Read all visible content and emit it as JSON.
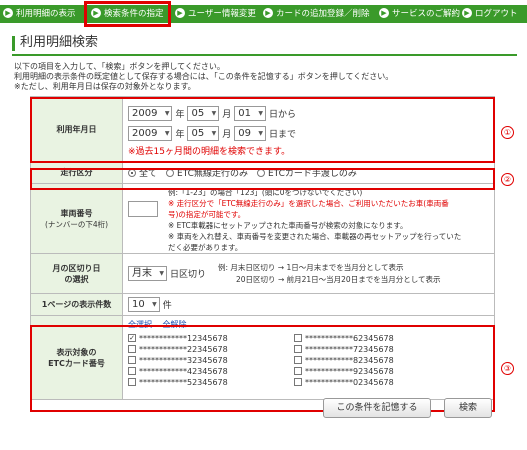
{
  "nav": {
    "items": [
      "利用明細の表示",
      "検索条件の指定",
      "ユーザー情報変更",
      "カードの追加登録／削除",
      "サービスのご解約",
      "ログアウト"
    ]
  },
  "page": {
    "title": "利用明細検索",
    "intro": [
      "以下の項目を入力して、「検索」ボタンを押してください。",
      "利用明細の表示条件の既定値として保存する場合には、「この条件を記憶する」ボタンを押してください。",
      "※ただし、利用年月日は保存の対象外となります。"
    ]
  },
  "date": {
    "label": "利用年月日",
    "from": {
      "year": "2009",
      "month": "05",
      "day": "01",
      "suffix": "日から"
    },
    "to": {
      "year": "2009",
      "month": "05",
      "day": "09",
      "suffix": "日まで"
    },
    "year_unit": "年",
    "month_unit": "月",
    "warning": "※過去15ヶ月間の明細を検索できます。"
  },
  "route": {
    "label": "走行区分",
    "options": [
      "全て",
      "ETC無線走行のみ",
      "ETCカード手渡しのみ"
    ],
    "selected": 0
  },
  "vehicle": {
    "label": "車両番号",
    "sub": "(ナンバーの下4桁)",
    "example": "例:「1-23」の場合「123」(頭に0をつけないでください)",
    "notes": [
      {
        "text": "※ 走行区分で「ETC無線走行のみ」を選択した場合、ご利用いただいたお車(車両番",
        "red": true
      },
      {
        "text": "号)の指定が可能です。",
        "red": true
      },
      {
        "text": "※ ETC車載器にセットアップされた車両番号が検索の対象になります。",
        "red": false
      },
      {
        "text": "※ 車両を入れ替え、車両番号を変更された場合、車載器の再セットアップを行っていた",
        "red": false
      },
      {
        "text": "だく必要があります。",
        "red": false
      }
    ]
  },
  "cutoff": {
    "label": "月の区切り日",
    "label2": "の選択",
    "value": "月末",
    "unit": "日区切り",
    "examples": [
      "例:  月末日区切り   →  1日～月末までを当月分として表示",
      "20日区切り   →  前月21日～当月20日までを当月分として表示"
    ]
  },
  "per_page": {
    "label": "1ページの表示件数",
    "value": "10",
    "unit": "件"
  },
  "cards": {
    "label": "表示対象の",
    "label2": "ETCカード番号",
    "select_all": "全選択",
    "clear_all": "全解除",
    "items": [
      {
        "number": "************12345678",
        "checked": true
      },
      {
        "number": "************62345678",
        "checked": false
      },
      {
        "number": "************22345678",
        "checked": false
      },
      {
        "number": "************72345678",
        "checked": false
      },
      {
        "number": "************32345678",
        "checked": false
      },
      {
        "number": "************82345678",
        "checked": false
      },
      {
        "number": "************42345678",
        "checked": false
      },
      {
        "number": "************92345678",
        "checked": false
      },
      {
        "number": "************52345678",
        "checked": false
      },
      {
        "number": "************02345678",
        "checked": false
      }
    ]
  },
  "markers": [
    "①",
    "②",
    "③"
  ],
  "buttons": {
    "save": "この条件を記憶する",
    "search": "検索"
  },
  "colors": {
    "accent": "#3a9a2a",
    "highlight": "#e00000",
    "label_bg": "#e9f3e2"
  }
}
